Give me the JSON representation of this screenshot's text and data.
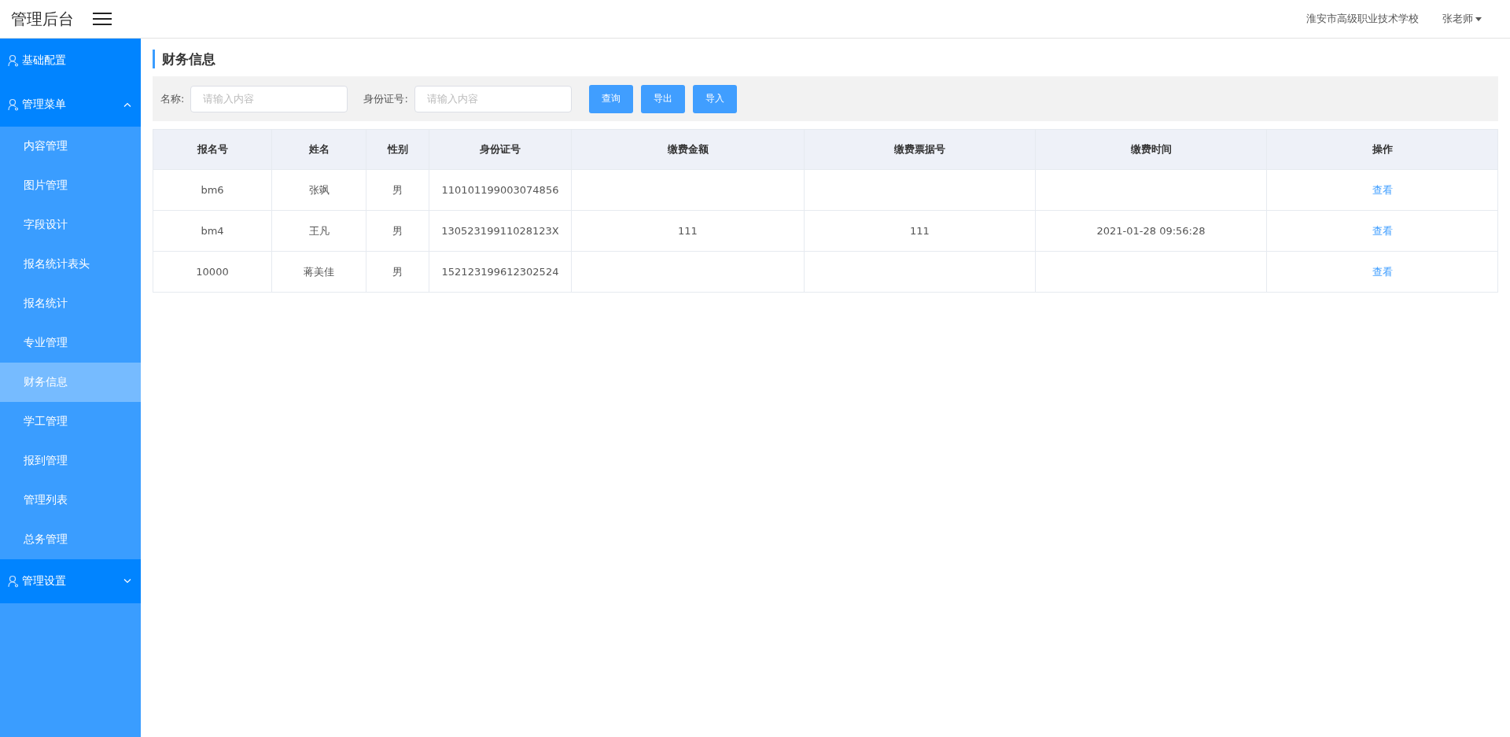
{
  "header": {
    "title": "管理后台",
    "school": "淮安市高级职业技术学校",
    "user": "张老师"
  },
  "sidebar": {
    "groups": [
      {
        "kind": "link",
        "label": "基础配置"
      },
      {
        "kind": "submenu",
        "label": "管理菜单",
        "expanded": true,
        "children": [
          {
            "label": "内容管理",
            "selected": false
          },
          {
            "label": "图片管理",
            "selected": false
          },
          {
            "label": "字段设计",
            "selected": false
          },
          {
            "label": "报名统计表头",
            "selected": false
          },
          {
            "label": "报名统计",
            "selected": false
          },
          {
            "label": "专业管理",
            "selected": false
          },
          {
            "label": "财务信息",
            "selected": true
          },
          {
            "label": "学工管理",
            "selected": false
          },
          {
            "label": "报到管理",
            "selected": false
          },
          {
            "label": "管理列表",
            "selected": false
          },
          {
            "label": "总务管理",
            "selected": false
          }
        ]
      },
      {
        "kind": "submenu",
        "label": "管理设置",
        "expanded": false
      }
    ]
  },
  "page_title": "财务信息",
  "filters": [
    {
      "label": "名称:",
      "placeholder": "请输入内容"
    },
    {
      "label": "身份证号:",
      "placeholder": "请输入内容"
    }
  ],
  "buttons": [
    "查询",
    "导出",
    "导入"
  ],
  "table": {
    "columns": [
      "报名号",
      "姓名",
      "性别",
      "身份证号",
      "缴费金额",
      "缴费票据号",
      "缴费时间",
      "操作"
    ],
    "rows": [
      {
        "cells": [
          "bm6",
          "张飒",
          "男",
          "110101199003074856",
          "",
          "",
          ""
        ],
        "action": "查看"
      },
      {
        "cells": [
          "bm4",
          "王凡",
          "男",
          "13052319911028123X",
          "111",
          "111",
          "2021-01-28 09:56:28"
        ],
        "action": "查看"
      },
      {
        "cells": [
          "10000",
          "蒋美佳",
          "男",
          "152123199612302524",
          "",
          "",
          ""
        ],
        "action": "查看"
      }
    ]
  }
}
